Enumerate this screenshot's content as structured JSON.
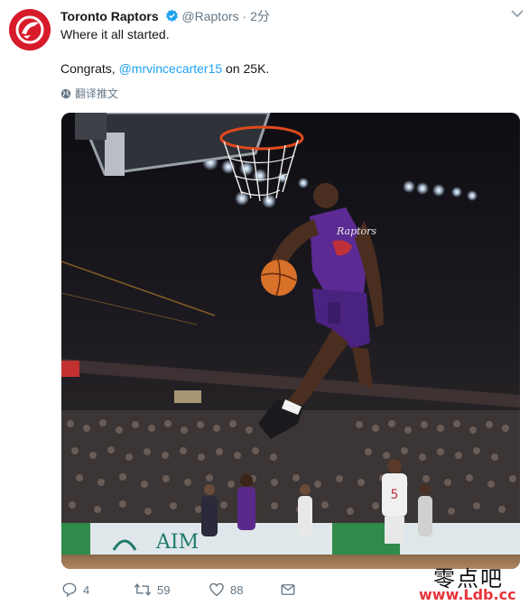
{
  "tweet": {
    "display_name": "Toronto Raptors",
    "handle": "@Raptors",
    "separator": "·",
    "time": "2分",
    "text_line1": "Where it all started.",
    "text_prefix": "Congrats, ",
    "mention": "@mrvincecarter15",
    "text_suffix": " on 25K.",
    "translate_label": "翻译推文"
  },
  "photo": {
    "jersey_number": "5",
    "sign_text": "AIM"
  },
  "actions": {
    "reply_count": "4",
    "retweet_count": "59",
    "like_count": "88"
  },
  "watermark": {
    "chinese": "零点吧",
    "url": "www.Ldb.cc"
  },
  "colors": {
    "brand_red": "#d71b2a",
    "link_blue": "#1da1f2",
    "muted_gray": "#657786",
    "watermark_red": "#e8343a"
  }
}
